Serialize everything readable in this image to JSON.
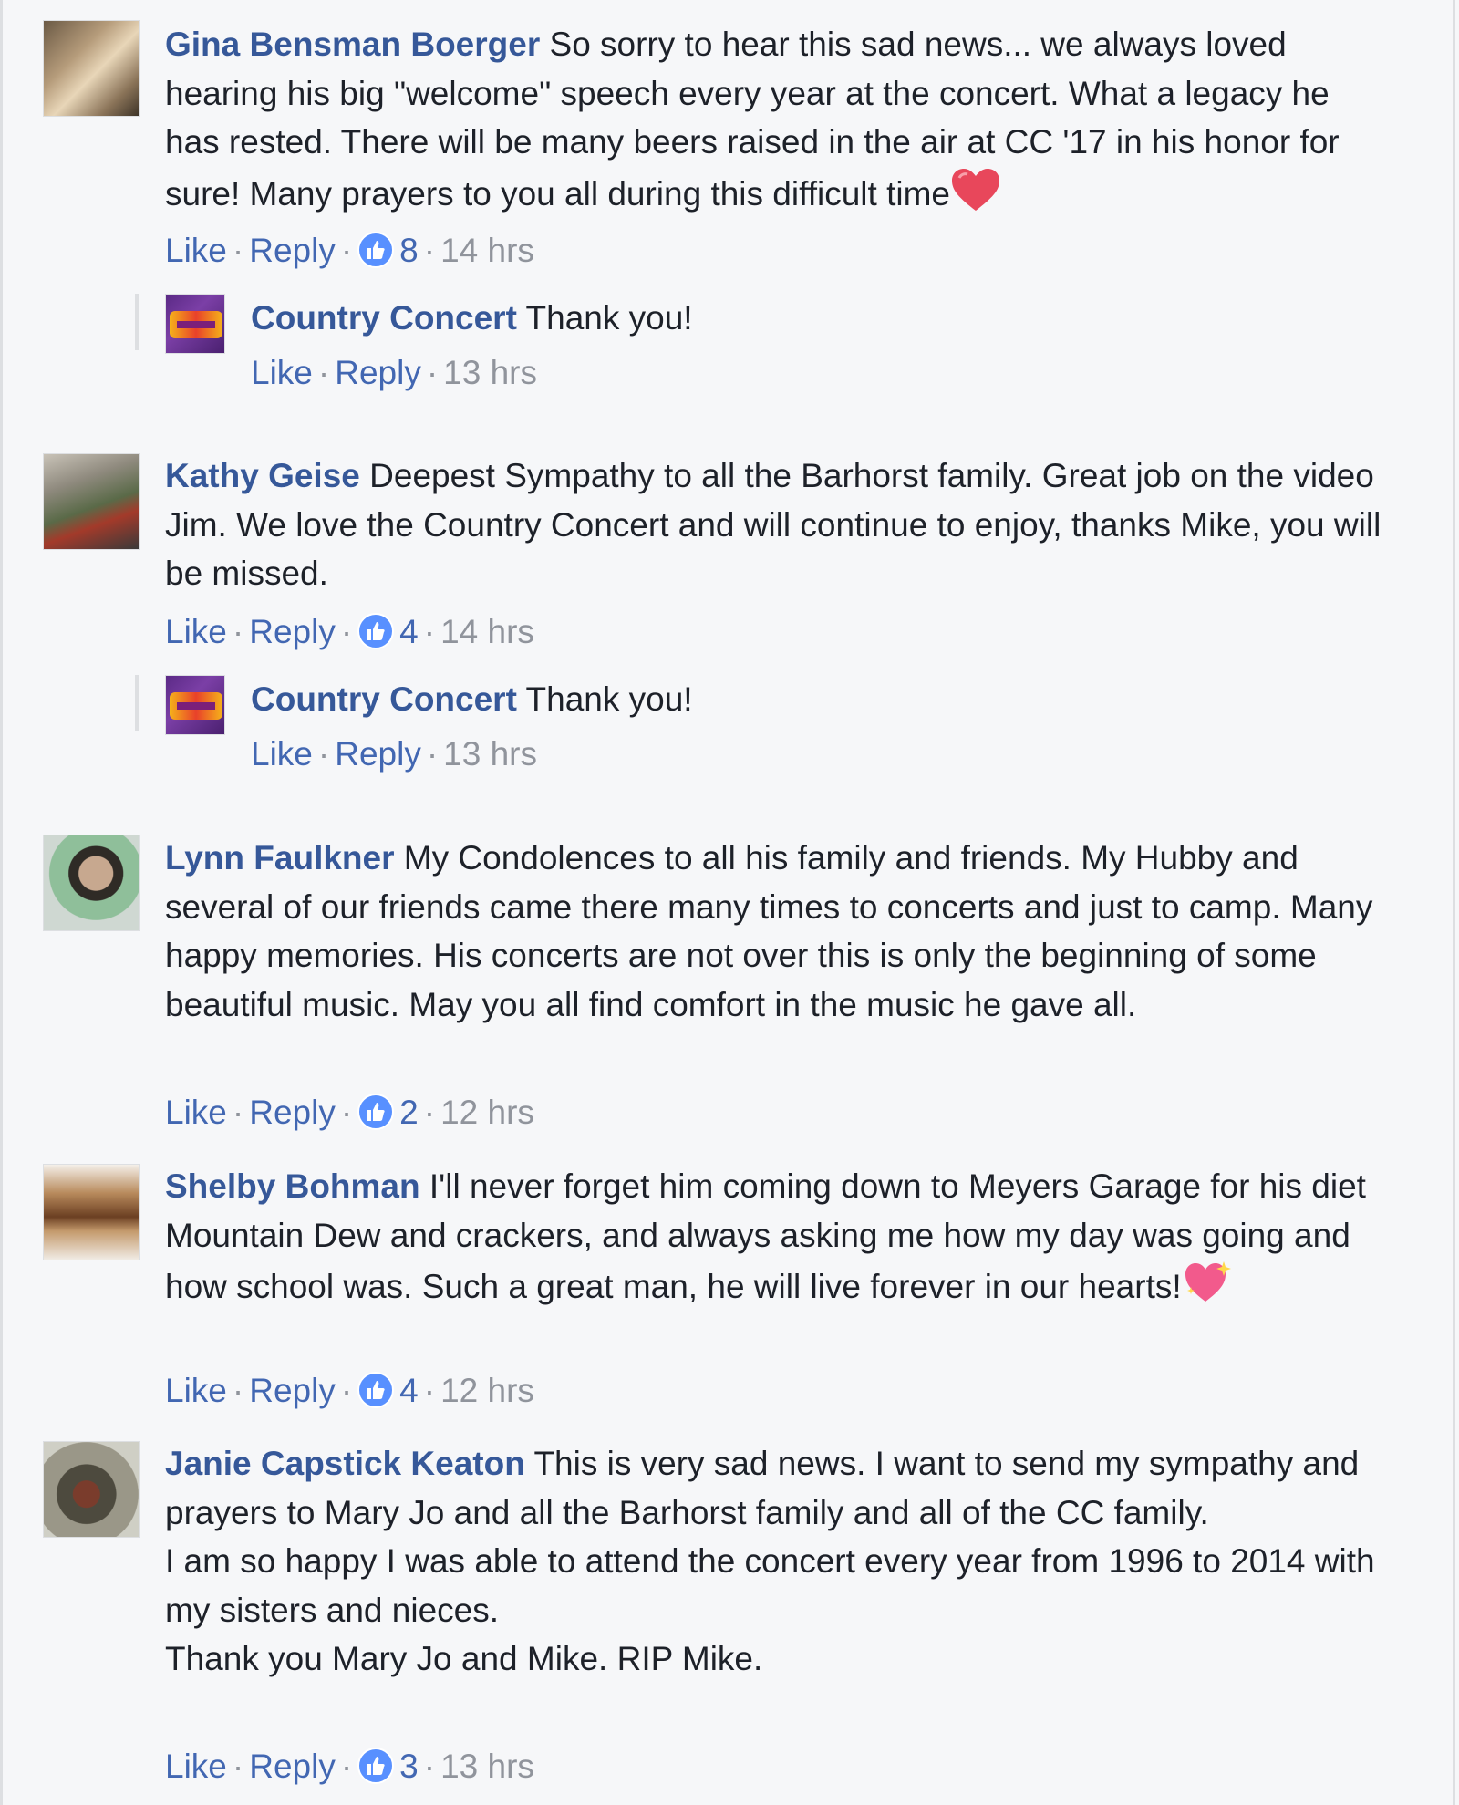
{
  "actions": {
    "like": "Like",
    "reply": "Reply",
    "dot": "·"
  },
  "comments": [
    {
      "name": "Gina Bensman Boerger",
      "text": "So sorry to hear this sad news... we always loved hearing his big \"welcome\" speech every year at the concert. What a legacy he has rested. There will be many beers raised in the air at CC '17 in his honor for sure! Many prayers to you all during this difficult time",
      "emoji": "red-heart-icon",
      "likes": "8",
      "time": "14 hrs",
      "reply": {
        "name": "Country Concert",
        "text": "Thank you!",
        "time": "13 hrs"
      }
    },
    {
      "name": "Kathy Geise",
      "text": "Deepest Sympathy to all the Barhorst family. Great job on the video Jim. We love the Country Concert and will continue to enjoy, thanks Mike, you will be missed.",
      "likes": "4",
      "time": "14 hrs",
      "reply": {
        "name": "Country Concert",
        "text": "Thank you!",
        "time": "13 hrs"
      }
    },
    {
      "name": "Lynn Faulkner",
      "text": "My Condolences to all his family and friends. My Hubby and several of our friends came there many times to concerts and just to camp. Many happy memories. His concerts are not over this is only the beginning of some beautiful music. May you all find comfort in the music he gave all.",
      "likes": "2",
      "time": "12 hrs"
    },
    {
      "name": "Shelby Bohman",
      "text": "I'll never forget him coming down to Meyers Garage for his diet Mountain Dew and crackers, and always asking me how my day was going and how school was. Such a great man, he will live forever in our hearts!",
      "emoji": "sparkling-heart-icon",
      "likes": "4",
      "time": "12 hrs"
    },
    {
      "name": "Janie Capstick Keaton",
      "text": "This is very sad news. I want to send my sympathy and prayers to Mary Jo and all the Barhorst family and all of the CC family.",
      "text2": "I am so happy I was able to attend the concert every year from 1996 to 2014 with my sisters and nieces.",
      "text3": "Thank you Mary Jo and Mike. RIP Mike.",
      "likes": "3",
      "time": "13 hrs"
    }
  ],
  "colors": {
    "name": "#365899",
    "link": "#4267b2",
    "meta": "#90949c",
    "like_badge": "#5890ff",
    "background": "#f6f7f9"
  }
}
